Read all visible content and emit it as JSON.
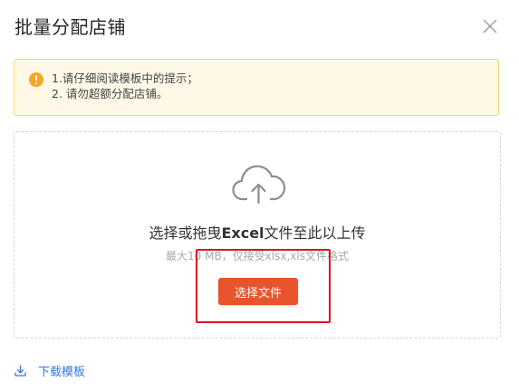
{
  "dialog": {
    "title": "批量分配店铺"
  },
  "notice": {
    "line1": "1.请仔细阅读模板中的提示；",
    "line2": "2. 请勿超额分配店铺。",
    "icon": "warning-icon",
    "color": "#f5a623"
  },
  "upload": {
    "icon": "cloud-upload-icon",
    "heading_prefix": "选择或拖曳",
    "heading_bold": "Excel",
    "heading_suffix": "文件至此以上传",
    "hint": "最大10 MB，仅接受xlsx,xls文件格式",
    "button_label": "选择文件",
    "button_color": "#e8542b"
  },
  "footer": {
    "download_label": "下载模板",
    "download_icon": "download-icon",
    "link_color": "#2f7ad8"
  }
}
